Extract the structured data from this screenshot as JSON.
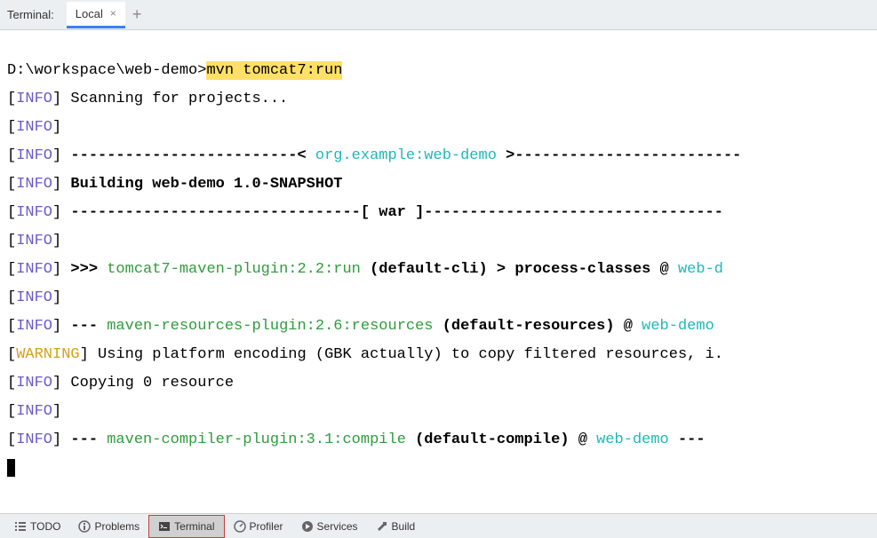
{
  "top": {
    "label": "Terminal:",
    "tab_name": "Local"
  },
  "terminal": {
    "prompt": "D:\\workspace\\web-demo>",
    "command": "mvn tomcat7:run",
    "lines": {
      "scanning": "Scanning for projects...",
      "artifact": "org.example:web-demo",
      "building": "Building web-demo 1.0-SNAPSHOT",
      "packaging": "[ war ]",
      "tomcat_plugin": "tomcat7-maven-plugin:2.2:run",
      "tomcat_goal": "(default-cli) > process-classes @",
      "project1": "web-d",
      "resources_plugin": "maven-resources-plugin:2.6:resources",
      "resources_goal": "(default-resources) @",
      "project2": "web-demo",
      "warning_text": "Using platform encoding (GBK actually) to copy filtered resources, i.",
      "copying": "Copying 0 resource",
      "compiler_plugin": "maven-compiler-plugin:3.1:compile",
      "compiler_goal": "(default-compile) @",
      "project3": "web-demo"
    },
    "tags": {
      "info": "INFO",
      "warning": "WARNING"
    }
  },
  "bottom": {
    "todo": "TODO",
    "problems": "Problems",
    "terminal": "Terminal",
    "profiler": "Profiler",
    "services": "Services",
    "build": "Build"
  }
}
